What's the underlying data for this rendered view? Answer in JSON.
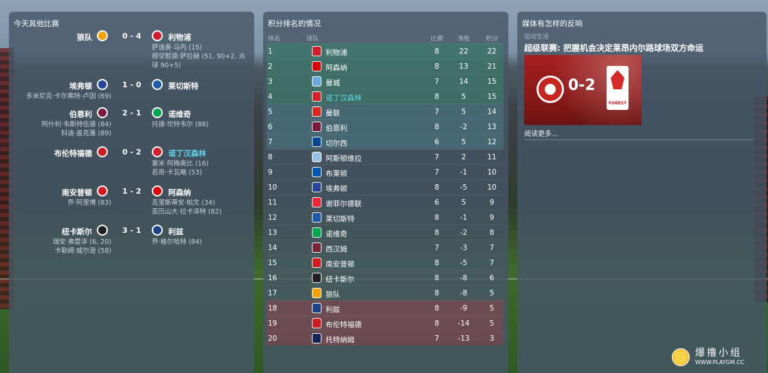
{
  "colors": {
    "panel_bg": "#465666",
    "highlight": "#60d4e6",
    "ucl": "#388468",
    "uel": "#4a7884",
    "relegation": "#8c424a"
  },
  "results": {
    "title": "今天其他比赛",
    "matches": [
      {
        "home": "狼队",
        "score": "0 - 4",
        "away": "利物浦",
        "home_color": "#f4a300",
        "away_color": "#d21d2a",
        "home_scorers": "",
        "away_scorers": "萨迪奥·马内 (15)\n穆罕默德·萨拉赫 (51, 90+2, 点\n球 90+5)",
        "away_highlight": false
      },
      {
        "home": "埃弗顿",
        "score": "1 - 0",
        "away": "莱切斯特",
        "home_color": "#27449b",
        "away_color": "#1e5aae",
        "home_scorers": "多米尼克·卡尔弗特-卢因 (69)",
        "away_scorers": "",
        "away_highlight": false
      },
      {
        "home": "伯恩利",
        "score": "2 - 1",
        "away": "诺维奇",
        "home_color": "#7b1b3d",
        "away_color": "#00a84f",
        "home_scorers": "阿什利·韦斯特伍德 (84)\n科迪·盖克蓬 (89)",
        "away_scorers": "托德·坎特韦尔 (88)",
        "away_highlight": false
      },
      {
        "home": "布伦特福德",
        "score": "0 - 2",
        "away": "诺丁汉森林",
        "home_color": "#d01c1f",
        "away_color": "#d32029",
        "home_scorers": "",
        "away_scorers": "塞米·阿梅奥比 (16)\n若昂·卡瓦略 (53)",
        "away_highlight": true
      },
      {
        "home": "南安普顿",
        "score": "1 - 2",
        "away": "阿森纳",
        "home_color": "#d71920",
        "away_color": "#db0007",
        "home_scorers": "乔·阿里博 (83)",
        "away_scorers": "克里斯蒂安·帕文 (34)\n亚历山大·拉卡泽特 (82)",
        "away_highlight": false
      },
      {
        "home": "纽卡斯尔",
        "score": "3 - 1",
        "away": "利兹",
        "home_color": "#241f20",
        "away_color": "#1d428a",
        "home_scorers": "瑞安·弗雷泽 (6, 20)\n卡勒姆·威尔逊 (58)",
        "away_scorers": "乔·格尔哈特 (84)",
        "away_highlight": false
      }
    ]
  },
  "table": {
    "title": "积分排名的情况",
    "headers": {
      "pos": "排名",
      "team": "球队",
      "played": "比赛",
      "gd": "净胜",
      "pts": "积分"
    },
    "rows": [
      {
        "pos": "1",
        "team": "利物浦",
        "played": "8",
        "gd": "22",
        "pts": "22",
        "color": "#d21d2a",
        "zone": "ucl"
      },
      {
        "pos": "2",
        "team": "阿森纳",
        "played": "8",
        "gd": "13",
        "pts": "21",
        "color": "#db0007",
        "zone": "ucl"
      },
      {
        "pos": "3",
        "team": "曼城",
        "played": "7",
        "gd": "14",
        "pts": "15",
        "color": "#6cabdd",
        "zone": "ucl"
      },
      {
        "pos": "4",
        "team": "诺丁汉森林",
        "played": "8",
        "gd": "5",
        "pts": "15",
        "color": "#d32029",
        "zone": "ucl",
        "highlight": true
      },
      {
        "pos": "5",
        "team": "曼联",
        "played": "7",
        "gd": "5",
        "pts": "14",
        "color": "#da291c",
        "zone": "uel"
      },
      {
        "pos": "6",
        "team": "伯恩利",
        "played": "8",
        "gd": "-2",
        "pts": "13",
        "color": "#7b1b3d",
        "zone": "uel"
      },
      {
        "pos": "7",
        "team": "切尔西",
        "played": "6",
        "gd": "5",
        "pts": "12",
        "color": "#034694",
        "zone": "uel"
      },
      {
        "pos": "8",
        "team": "阿斯顿维拉",
        "played": "7",
        "gd": "2",
        "pts": "11",
        "color": "#95bfe5",
        "zone": ""
      },
      {
        "pos": "9",
        "team": "布莱顿",
        "played": "7",
        "gd": "-1",
        "pts": "10",
        "color": "#0057b8",
        "zone": ""
      },
      {
        "pos": "10",
        "team": "埃弗顿",
        "played": "8",
        "gd": "-5",
        "pts": "10",
        "color": "#27449b",
        "zone": ""
      },
      {
        "pos": "11",
        "team": "谢菲尔德联",
        "played": "6",
        "gd": "5",
        "pts": "9",
        "color": "#ee2737",
        "zone": ""
      },
      {
        "pos": "12",
        "team": "莱切斯特",
        "played": "8",
        "gd": "-1",
        "pts": "9",
        "color": "#1e5aae",
        "zone": ""
      },
      {
        "pos": "13",
        "team": "诺维奇",
        "played": "8",
        "gd": "-2",
        "pts": "8",
        "color": "#00a84f",
        "zone": ""
      },
      {
        "pos": "14",
        "team": "西汉姆",
        "played": "7",
        "gd": "-3",
        "pts": "7",
        "color": "#7a263a",
        "zone": ""
      },
      {
        "pos": "15",
        "team": "南安普顿",
        "played": "8",
        "gd": "-5",
        "pts": "7",
        "color": "#d71920",
        "zone": ""
      },
      {
        "pos": "16",
        "team": "纽卡斯尔",
        "played": "8",
        "gd": "-8",
        "pts": "6",
        "color": "#241f20",
        "zone": ""
      },
      {
        "pos": "17",
        "team": "狼队",
        "played": "8",
        "gd": "-8",
        "pts": "5",
        "color": "#f4a300",
        "zone": ""
      },
      {
        "pos": "18",
        "team": "利兹",
        "played": "8",
        "gd": "-9",
        "pts": "5",
        "color": "#1d428a",
        "zone": "rel"
      },
      {
        "pos": "19",
        "team": "布伦特福德",
        "played": "8",
        "gd": "-14",
        "pts": "5",
        "color": "#d01c1f",
        "zone": "rel"
      },
      {
        "pos": "20",
        "team": "托特纳姆",
        "played": "7",
        "gd": "-13",
        "pts": "3",
        "color": "#132257",
        "zone": "rel"
      }
    ]
  },
  "news": {
    "title": "媒体有怎样的反响",
    "category": "运动生活",
    "headline": "超级联赛: 把握机会决定莱昂内尔路球场双方命运",
    "image_score": "0-2",
    "image_badge_text": "FOREST",
    "read_more": "阅读更多..."
  },
  "watermark": {
    "brand": "爆撸小组",
    "url": "WWW.PLAYGM.CC"
  }
}
